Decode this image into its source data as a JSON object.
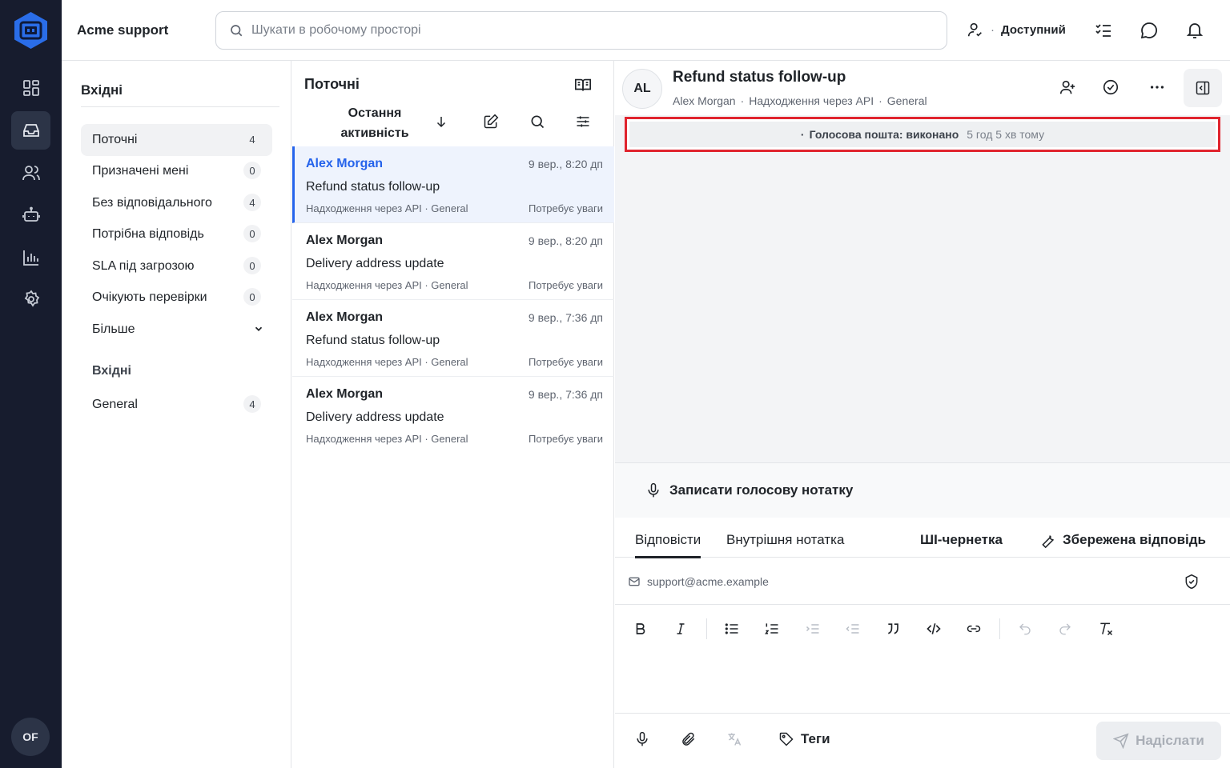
{
  "app": {
    "brand": "Acme support",
    "user_initials": "OF",
    "accent_color": "#2563eb",
    "rail_color": "#171c2e"
  },
  "rail": {
    "items": [
      {
        "icon": "dashboard-icon"
      },
      {
        "icon": "inbox-icon",
        "active": true
      },
      {
        "icon": "contacts-icon"
      },
      {
        "icon": "bot-icon"
      },
      {
        "icon": "reports-icon"
      },
      {
        "icon": "settings-icon"
      }
    ]
  },
  "topbar": {
    "search_placeholder": "Шукати в робочому просторі",
    "availability": "Доступний",
    "availability_separator": "·"
  },
  "folders": {
    "title": "Вхідні",
    "items": [
      {
        "label": "Поточні",
        "count": "4",
        "active": true
      },
      {
        "label": "Призначені мені",
        "count": "0"
      },
      {
        "label": "Без відповідального",
        "count": "4"
      },
      {
        "label": "Потрібна відповідь",
        "count": "0"
      },
      {
        "label": "SLA під загрозою",
        "count": "0"
      },
      {
        "label": "Очікують перевірки",
        "count": "0"
      }
    ],
    "more_label": "Більше",
    "inbox_section_label": "Вхідні",
    "inbox_items": [
      {
        "label": "General",
        "count": "4"
      }
    ]
  },
  "conversation_list": {
    "title": "Поточні",
    "sort_label": "Остання активність",
    "conversations": [
      {
        "name": "Alex Morgan",
        "time": "9 вер., 8:20 дп",
        "subject": "Refund status follow-up",
        "meta": "Надходження через API · General",
        "flag": "Потребує уваги",
        "active": true
      },
      {
        "name": "Alex Morgan",
        "time": "9 вер., 8:20 дп",
        "subject": "Delivery address update",
        "meta": "Надходження через API · General",
        "flag": "Потребує уваги"
      },
      {
        "name": "Alex Morgan",
        "time": "9 вер., 7:36 дп",
        "subject": "Refund status follow-up",
        "meta": "Надходження через API · General",
        "flag": "Потребує уваги"
      },
      {
        "name": "Alex Morgan",
        "time": "9 вер., 7:36 дп",
        "subject": "Delivery address update",
        "meta": "Надходження через API · General",
        "flag": "Потребує уваги"
      }
    ]
  },
  "conversation": {
    "avatar_initials": "AL",
    "title": "Refund status follow-up",
    "contact": "Alex Morgan",
    "channel": "Надходження через API",
    "inbox": "General",
    "meta_separator": "·",
    "activity": {
      "prefix": "·",
      "text": "Голосова пошта: виконано",
      "time": "5 год 5 хв тому"
    }
  },
  "composer": {
    "voice_note_label": "Записати голосову нотатку",
    "tabs": {
      "reply": "Відповісти",
      "private_note": "Внутрішня нотатка",
      "ai_draft": "ШІ-чернетка",
      "saved_reply": "Збережена відповідь"
    },
    "from_email": "support@acme.example",
    "tags_label": "Теги",
    "send_label": "Надіслати"
  }
}
